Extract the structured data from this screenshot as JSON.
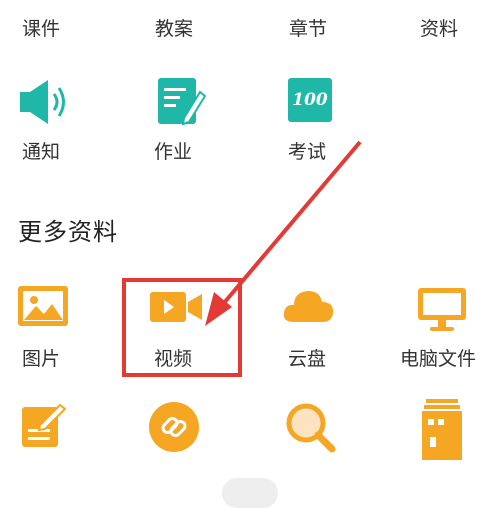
{
  "top_row": [
    "课件",
    "教案",
    "章节",
    "资料"
  ],
  "tools_row": [
    {
      "label": "通知",
      "icon": "speaker-icon"
    },
    {
      "label": "作业",
      "icon": "homework-icon"
    },
    {
      "label": "考试",
      "icon": "exam-100-icon",
      "icon_text": "100"
    }
  ],
  "more_section": {
    "title": "更多资料",
    "items": [
      {
        "label": "图片",
        "icon": "image-icon"
      },
      {
        "label": "视频",
        "icon": "video-icon"
      },
      {
        "label": "云盘",
        "icon": "cloud-icon"
      },
      {
        "label": "电脑文件",
        "icon": "monitor-icon"
      }
    ]
  },
  "colors": {
    "teal": "#1fb8a8",
    "orange": "#f5a623",
    "highlight": "#e53935"
  }
}
